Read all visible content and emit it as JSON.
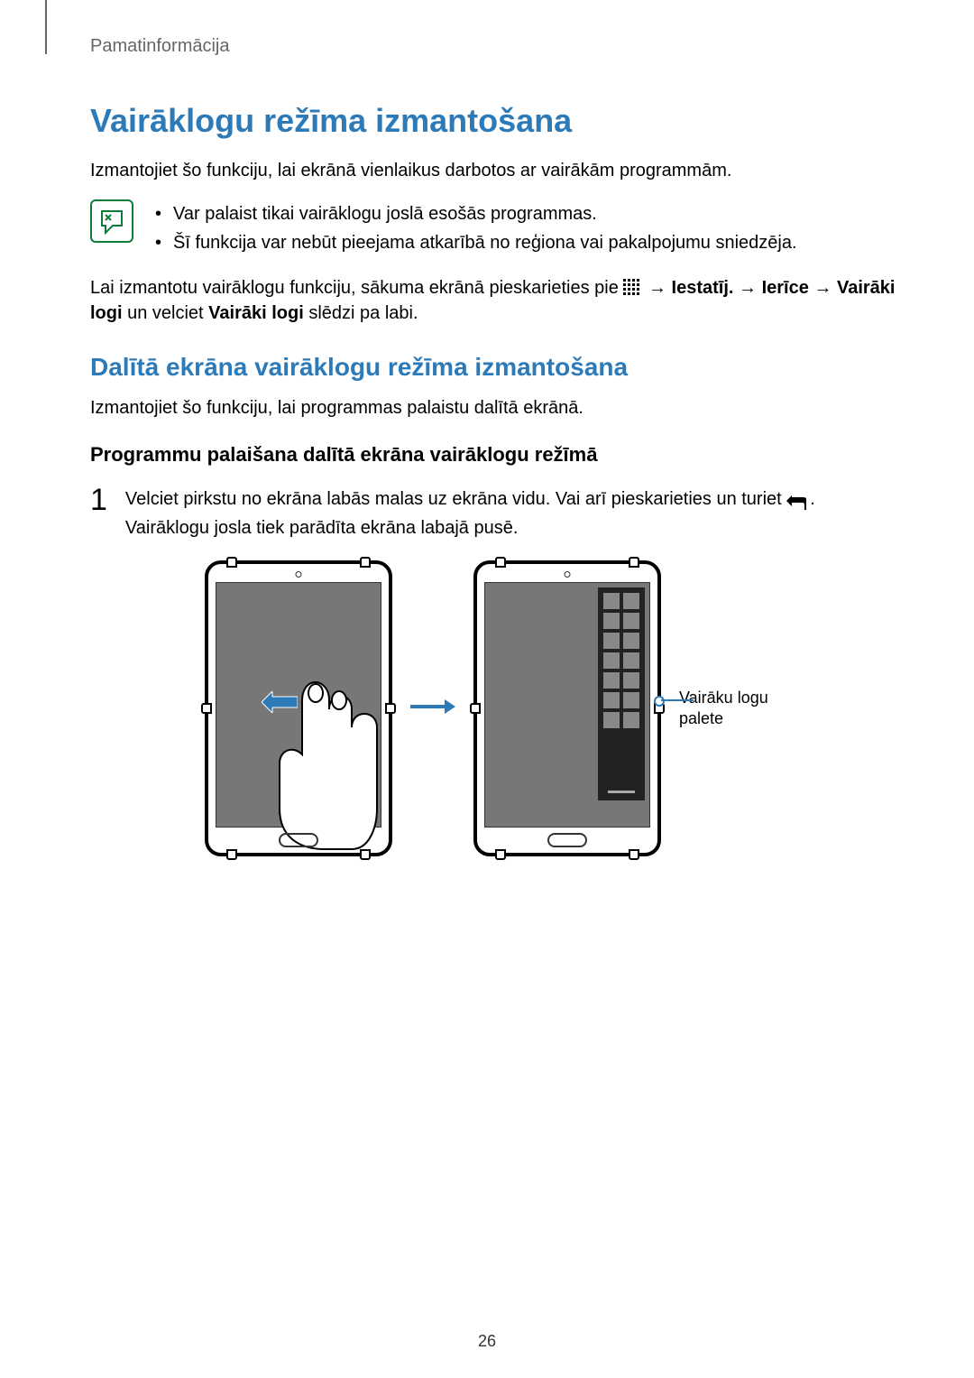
{
  "header": "Pamatinformācija",
  "h1": "Vairāklogu režīma izmantošana",
  "intro": "Izmantojiet šo funkciju, lai ekrānā vienlaikus darbotos ar vairākām programmām.",
  "notes": [
    "Var palaist tikai vairāklogu joslā esošās programmas.",
    "Šī funkcija var nebūt pieejama atkarībā no reģiona vai pakalpojumu sniedzēja."
  ],
  "para2_prefix": "Lai izmantotu vairāklogu funkciju, sākuma ekrānā pieskarieties pie ",
  "para2_arrow": " → ",
  "para2_bold1": "Iestatīj.",
  "para2_bold2": "Ierīce",
  "para2_bold3": "Vairāki logi",
  "para2_mid": " un velciet ",
  "para2_bold4": "Vairāki logi",
  "para2_suffix": " slēdzi pa labi.",
  "h2": "Dalītā ekrāna vairāklogu režīma izmantošana",
  "para3": "Izmantojiet šo funkciju, lai programmas palaistu dalītā ekrānā.",
  "h3": "Programmu palaišana dalītā ekrāna vairāklogu režīmā",
  "step1_num": "1",
  "step1_line1_prefix": "Velciet pirkstu no ekrāna labās malas uz ekrāna vidu. Vai arī pieskarieties un turiet ",
  "step1_line1_suffix": ".",
  "step1_line2": "Vairāklogu josla tiek parādīta ekrāna labajā pusē.",
  "callout": "Vairāku logu palete",
  "page_number": "26"
}
